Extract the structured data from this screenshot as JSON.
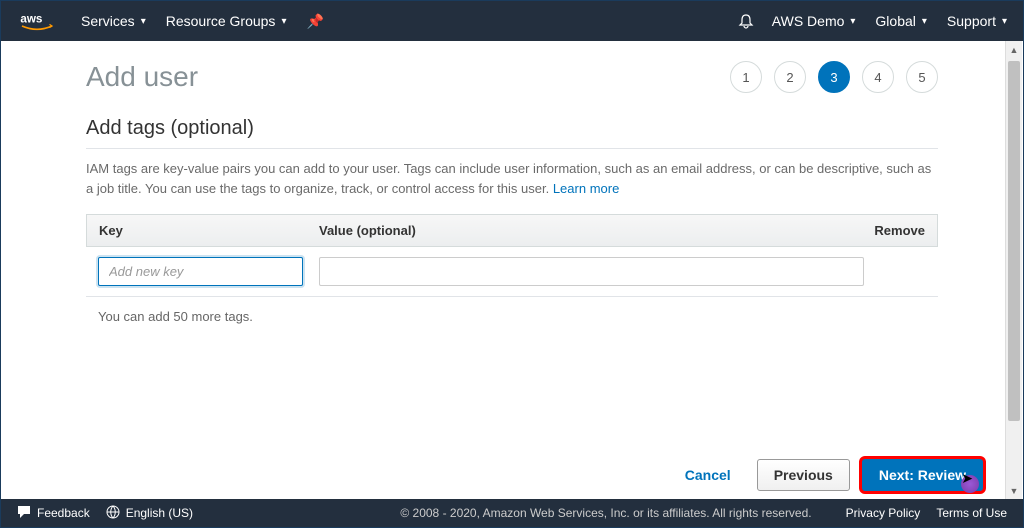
{
  "nav": {
    "services": "Services",
    "resource_groups": "Resource Groups",
    "account": "AWS Demo",
    "region": "Global",
    "support": "Support"
  },
  "page": {
    "title": "Add user",
    "steps": [
      "1",
      "2",
      "3",
      "4",
      "5"
    ],
    "active_step": 3
  },
  "section": {
    "heading": "Add tags (optional)",
    "description": "IAM tags are key-value pairs you can add to your user. Tags can include user information, such as an email address, or can be descriptive, such as a job title. You can use the tags to organize, track, or control access for this user. ",
    "learn_more": "Learn more"
  },
  "table": {
    "headers": {
      "key": "Key",
      "value": "Value (optional)",
      "remove": "Remove"
    },
    "key_placeholder": "Add new key",
    "remaining": "You can add 50 more tags."
  },
  "buttons": {
    "cancel": "Cancel",
    "previous": "Previous",
    "next": "Next: Review"
  },
  "footer": {
    "feedback": "Feedback",
    "language": "English (US)",
    "copyright": "© 2008 - 2020, Amazon Web Services, Inc. or its affiliates. All rights reserved.",
    "privacy": "Privacy Policy",
    "terms": "Terms of Use"
  }
}
